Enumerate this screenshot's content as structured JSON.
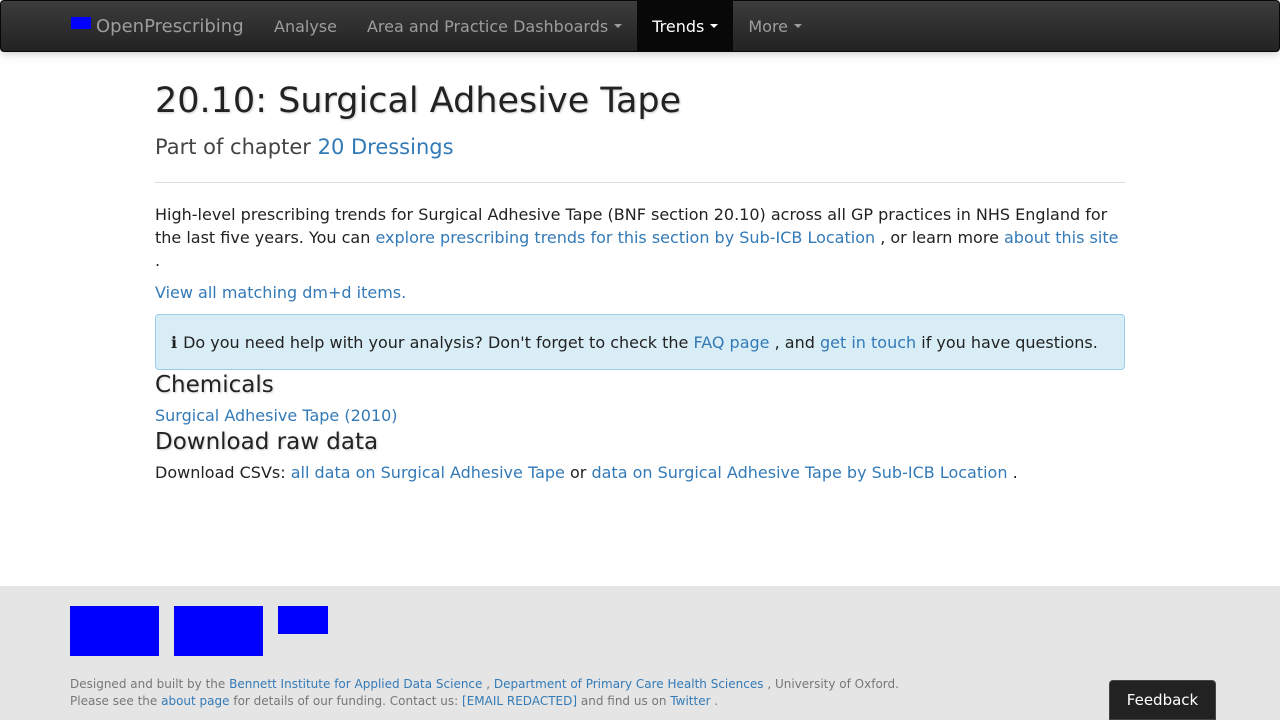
{
  "navbar": {
    "brand": "OpenPrescribing",
    "items": [
      {
        "label": "Analyse",
        "dropdown": false,
        "active": false
      },
      {
        "label": "Area and Practice Dashboards",
        "dropdown": true,
        "active": false
      },
      {
        "label": "Trends",
        "dropdown": true,
        "active": true
      },
      {
        "label": "More",
        "dropdown": true,
        "active": false
      }
    ]
  },
  "page": {
    "title": "20.10: Surgical Adhesive Tape",
    "subtitle_prefix": "Part of chapter",
    "chapter_link": "20 Dressings",
    "intro_text_1": "High-level prescribing trends for Surgical Adhesive Tape (BNF section 20.10) across all GP practices in NHS England for the last five years. You can",
    "intro_link_1": "explore prescribing trends for this section by Sub-ICB Location",
    "intro_text_2": ", or learn more",
    "intro_link_2": "about this site",
    "intro_text_3": ".",
    "dmd_link": "View all matching dm+d items.",
    "alert": {
      "icon": "info-icon",
      "icon_glyph": "ℹ",
      "text_1": "Do you need help with your analysis? Don't forget to check the",
      "faq_link": "FAQ page",
      "text_2": ", and",
      "contact_link": "get in touch",
      "text_3": "if you have questions."
    },
    "chemicals_heading": "Chemicals",
    "chemical_link": "Surgical Adhesive Tape (2010)",
    "download_heading": "Download raw data",
    "download_prefix": "Download CSVs:",
    "download_link_1": "all data on Surgical Adhesive Tape",
    "download_or": "or",
    "download_link_2": "data on Surgical Adhesive Tape by Sub-ICB Location",
    "download_end": "."
  },
  "footer": {
    "line1_prefix": "Designed and built by the",
    "bennett_link": "Bennett Institute for Applied Data Science",
    "comma": ",",
    "dept_link": "Department of Primary Care Health Sciences",
    "line1_suffix": ", University of Oxford.",
    "line2_prefix": "Please see the",
    "about_link": "about page",
    "line2_mid": "for details of our funding. Contact us:",
    "email_link": "[EMAIL REDACTED]",
    "line2_mid2": "and find us on",
    "twitter_link": "Twitter",
    "line2_end": "."
  },
  "feedback_button": "Feedback",
  "colors": {
    "navbar_bg": "#222222",
    "link": "#337ab7",
    "alert_bg": "#d9edf7",
    "footer_bg": "#e5e5e5",
    "logo_placeholder": "#0000ff"
  }
}
